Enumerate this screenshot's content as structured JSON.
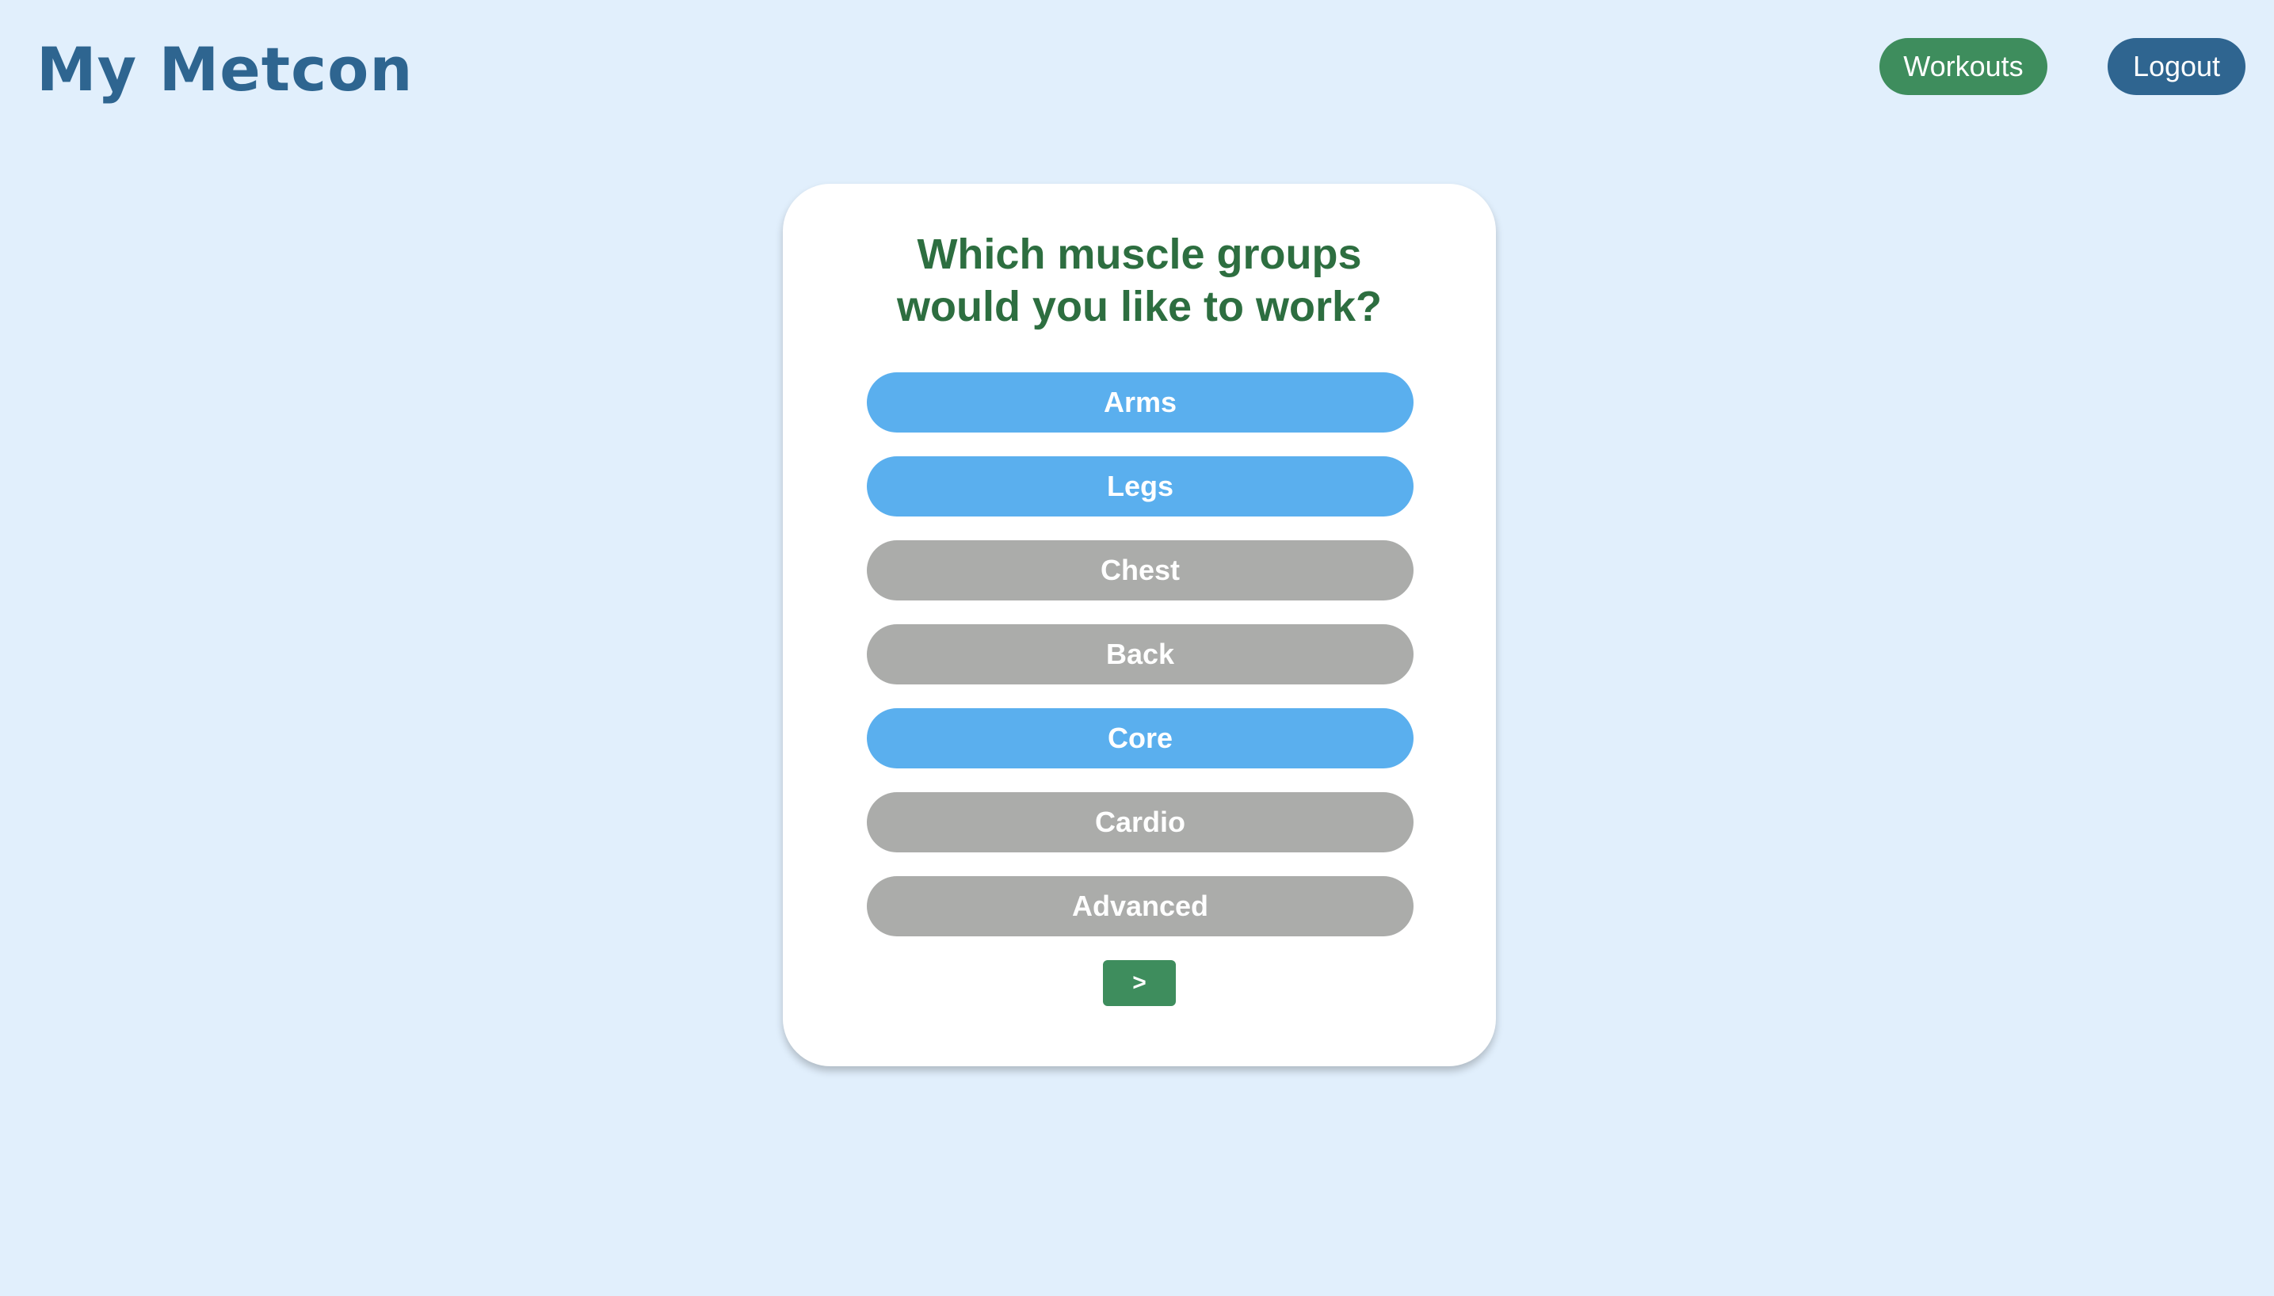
{
  "header": {
    "logo": "My Metcon",
    "nav": {
      "workouts_label": "Workouts",
      "logout_label": "Logout"
    }
  },
  "question": {
    "title_line1": "Which muscle groups",
    "title_line2": "would you like to work?"
  },
  "options": [
    {
      "label": "Arms",
      "selected": true
    },
    {
      "label": "Legs",
      "selected": true
    },
    {
      "label": "Chest",
      "selected": false
    },
    {
      "label": "Back",
      "selected": false
    },
    {
      "label": "Core",
      "selected": true
    },
    {
      "label": "Cardio",
      "selected": false
    },
    {
      "label": "Advanced",
      "selected": false
    }
  ],
  "next_label": ">",
  "colors": {
    "background": "#e1effc",
    "logo": "#2e6590",
    "title": "#2d6e40",
    "selected": "#5aafee",
    "unselected": "#abacaa",
    "primary_green": "#3e8d5d",
    "logout_blue": "#2f6590"
  }
}
